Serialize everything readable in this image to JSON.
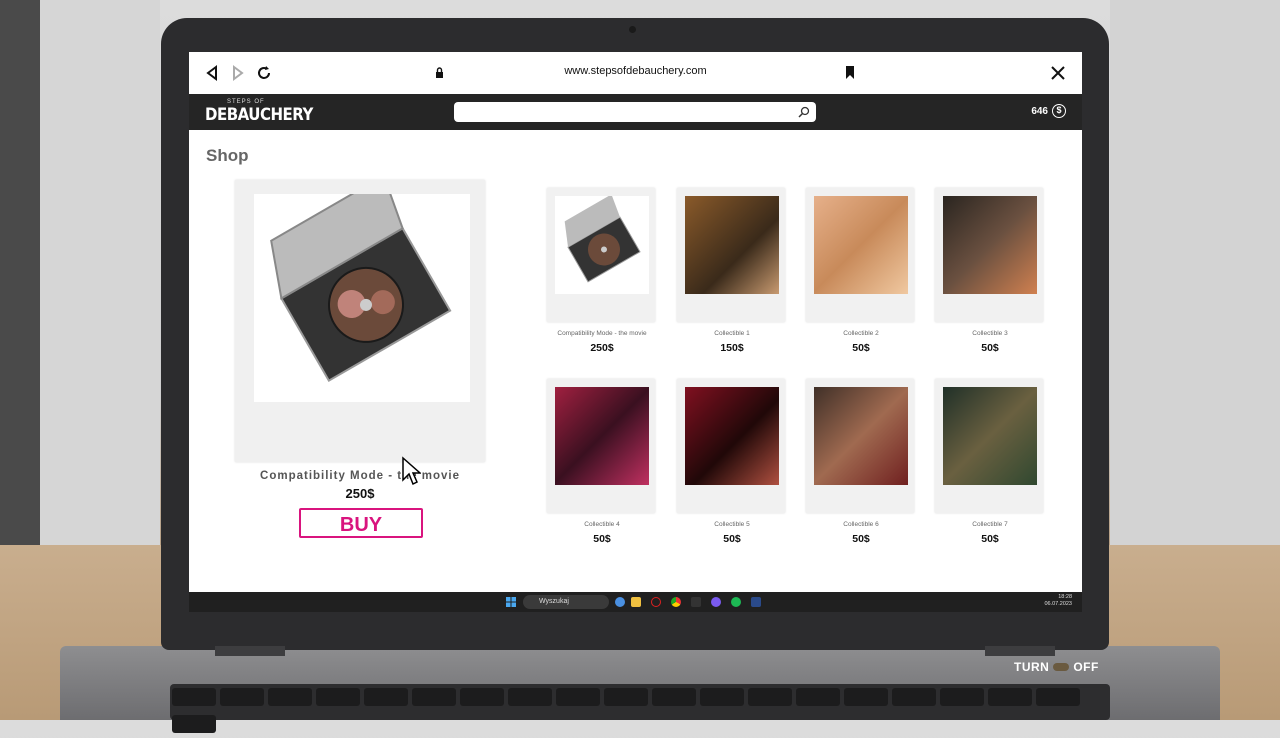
{
  "browser": {
    "url": "www.stepsofdebauchery.com"
  },
  "site": {
    "logo_small": "STEPS OF",
    "logo_big": "DEBAUCHERY",
    "search_placeholder": "",
    "money": "646"
  },
  "shop": {
    "title": "Shop",
    "featured": {
      "name": "Compatibility Mode - the movie",
      "price": "250$",
      "buy_label": "BUY"
    },
    "items": [
      {
        "label": "Compatibility Mode - the movie",
        "price": "250$"
      },
      {
        "label": "Collectible 1",
        "price": "150$"
      },
      {
        "label": "Collectible 2",
        "price": "50$"
      },
      {
        "label": "Collectible 3",
        "price": "50$"
      },
      {
        "label": "Collectible 4",
        "price": "50$"
      },
      {
        "label": "Collectible 5",
        "price": "50$"
      },
      {
        "label": "Collectible 6",
        "price": "50$"
      },
      {
        "label": "Collectible 7",
        "price": "50$"
      }
    ]
  },
  "taskbar": {
    "search_text": "Wyszukaj",
    "time": "18:28",
    "date": "06.07.2023"
  },
  "overlay": {
    "turn_label": "TURN",
    "off_label": "OFF"
  },
  "colors": {
    "accent": "#d9147e",
    "header_bg": "#252525"
  }
}
